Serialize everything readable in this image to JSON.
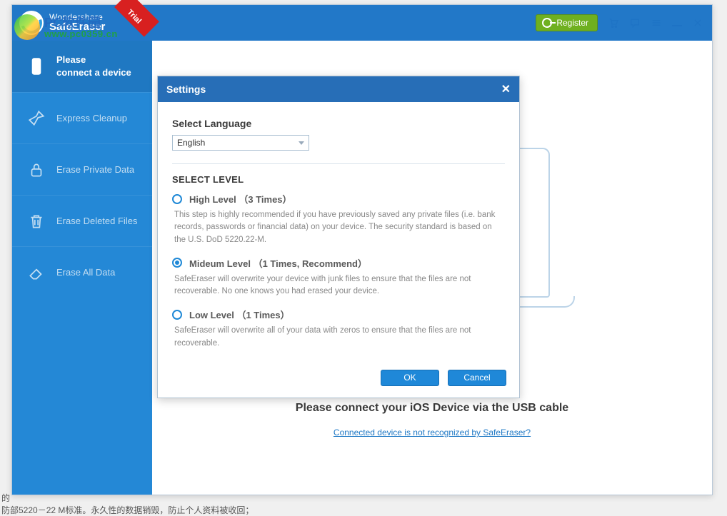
{
  "brand": {
    "line1": "Wondershare",
    "line2": "SafeEraser",
    "trial": "Trial"
  },
  "watermark": {
    "line1": "PC软件园",
    "line2": "www.pc0359.cn"
  },
  "titlebar": {
    "register": "Register"
  },
  "sidebar": {
    "connect_l1": "Please",
    "connect_l2": "connect a device",
    "express": "Express Cleanup",
    "private": "Erase Private Data",
    "deleted": "Erase Deleted Files",
    "all": "Erase All Data"
  },
  "main": {
    "connect_msg": "Please connect your iOS Device via the USB cable",
    "not_recognized": "Connected device is not recognized by SafeEraser?"
  },
  "dialog": {
    "title": "Settings",
    "select_language": "Select Language",
    "language_value": "English",
    "select_level": "SELECT LEVEL",
    "levels": {
      "high": {
        "label": "High Level （3 Times）",
        "desc": "This step is highly recommended if you have previously saved any private files (i.e. bank records, passwords or financial data) on your device. The security standard is based on the U.S. DoD 5220.22-M.",
        "checked": false
      },
      "medium": {
        "label": "Mideum Level （1 Times, Recommend）",
        "desc": "SafeEraser will overwrite your device with junk files to ensure that the files are not recoverable. No one knows you had erased your device.",
        "checked": true
      },
      "low": {
        "label": "Low Level （1 Times）",
        "desc": "SafeEraser will overwrite all of your data with zeros to ensure that the files are not recoverable.",
        "checked": false
      }
    },
    "ok": "OK",
    "cancel": "Cancel"
  },
  "bg": {
    "t1": "的",
    "t2": "防部5220－22 M标准。永久性的数据销毁，防止个人资料被收回；"
  }
}
